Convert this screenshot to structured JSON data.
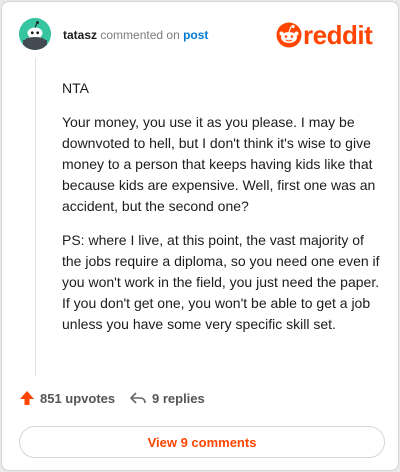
{
  "header": {
    "username": "tatasz",
    "commented_text": "commented on",
    "post_link": "post",
    "logo_text": "reddit",
    "avatar_icon": "snoo-avatar-icon",
    "brand_color": "#ff4500"
  },
  "comment": {
    "paragraphs": [
      "NTA",
      "Your money, you use it as you please. I may be downvoted to hell, but I don't think it's wise to give money to a person that keeps having kids like that because kids are expensive. Well, first one was an accident, but the second one?",
      "PS: where I live, at this point, the vast majority of the jobs require a diploma, so you need one even if you won't work in the field, you just need the paper. If you don't get one, you won't be able to get a job unless you have some very specific skill set."
    ]
  },
  "actions": {
    "upvotes": "851 upvotes",
    "replies": "9 replies",
    "upvote_icon": "upvote-arrow-icon",
    "reply_icon": "reply-arrow-icon"
  },
  "footer": {
    "view_comments": "View 9 comments"
  }
}
